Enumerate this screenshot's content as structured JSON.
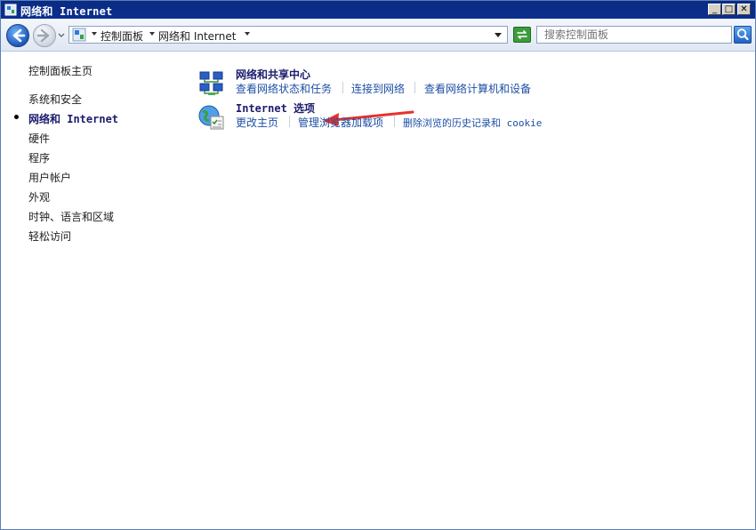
{
  "window": {
    "title": "网络和 Internet",
    "minimize": "_",
    "maximize": "□",
    "close": "✕"
  },
  "address": {
    "crumbs": [
      "控制面板",
      "网络和 Internet"
    ]
  },
  "search": {
    "placeholder": "搜索控制面板"
  },
  "sidebar": {
    "home": "控制面板主页",
    "items": [
      "系统和安全",
      "网络和 Internet",
      "硬件",
      "程序",
      "用户帐户",
      "外观",
      "时钟、语言和区域",
      "轻松访问"
    ],
    "current_index": 1
  },
  "categories": [
    {
      "title": "网络和共享中心",
      "icon": "network-sharing-icon",
      "tasks": [
        "查看网络状态和任务",
        "连接到网络",
        "查看网络计算机和设备"
      ]
    },
    {
      "title": "Internet 选项",
      "icon": "internet-options-icon",
      "tasks": [
        "更改主页",
        "管理浏览器加载项",
        "删除浏览的历史记录和 cookie"
      ]
    }
  ],
  "colors": {
    "titlebar": "#0a2b82",
    "link": "#1e4fa5",
    "heading": "#1c1c6e",
    "annotation_arrow": "#e8322c"
  }
}
